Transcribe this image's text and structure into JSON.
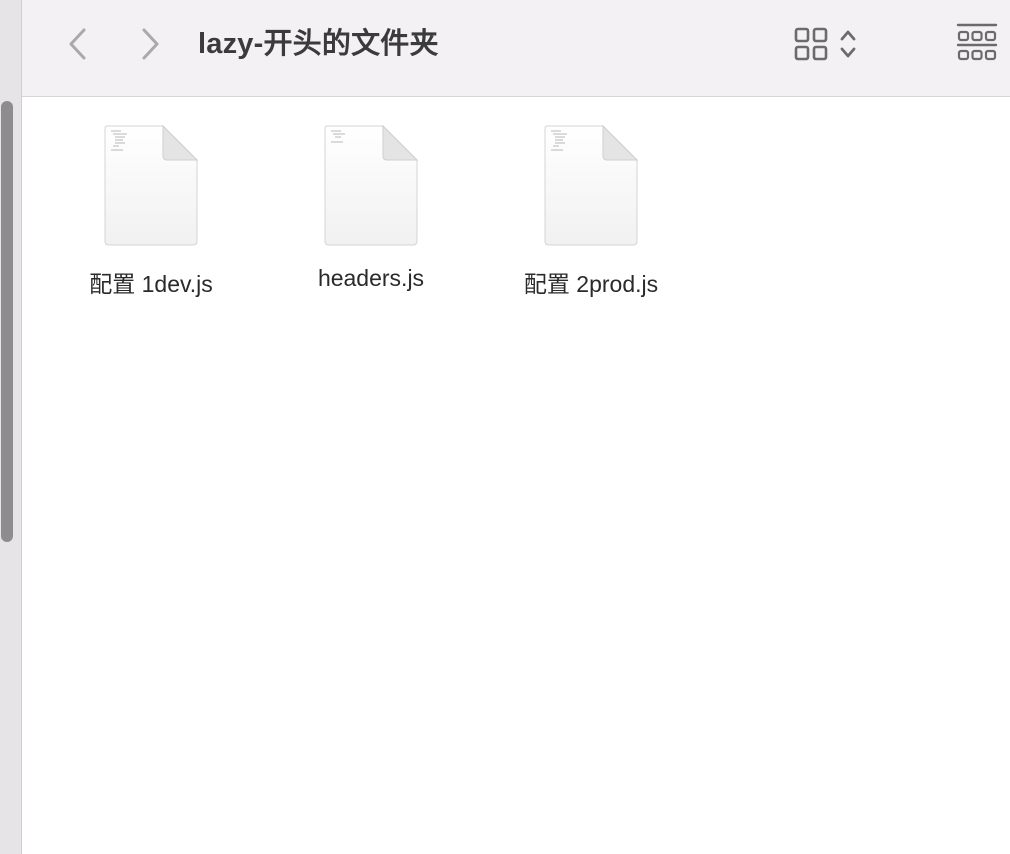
{
  "window": {
    "title": "lazy-开头的文件夹"
  },
  "toolbar": {
    "back_icon": "chevron-left-icon",
    "forward_icon": "chevron-right-icon",
    "view_icon": "icon-grid-view-icon",
    "view_toggle_icon": "chevron-up-down-icon",
    "group_icon": "group-by-icon"
  },
  "files": [
    {
      "name": "配置 1dev.js",
      "icon": "js-document-icon"
    },
    {
      "name": "headers.js",
      "icon": "js-document-icon"
    },
    {
      "name": "配置 2prod.js",
      "icon": "js-document-icon"
    }
  ],
  "colors": {
    "toolbar_bg": "#f3f1f3",
    "title_text": "#3b3a3c",
    "icon_gray": "#6b6a6d",
    "nav_disabled": "#a9a8aa",
    "sidebar_bg": "#e6e4e7",
    "scroll_thumb": "#8e8c8f"
  }
}
